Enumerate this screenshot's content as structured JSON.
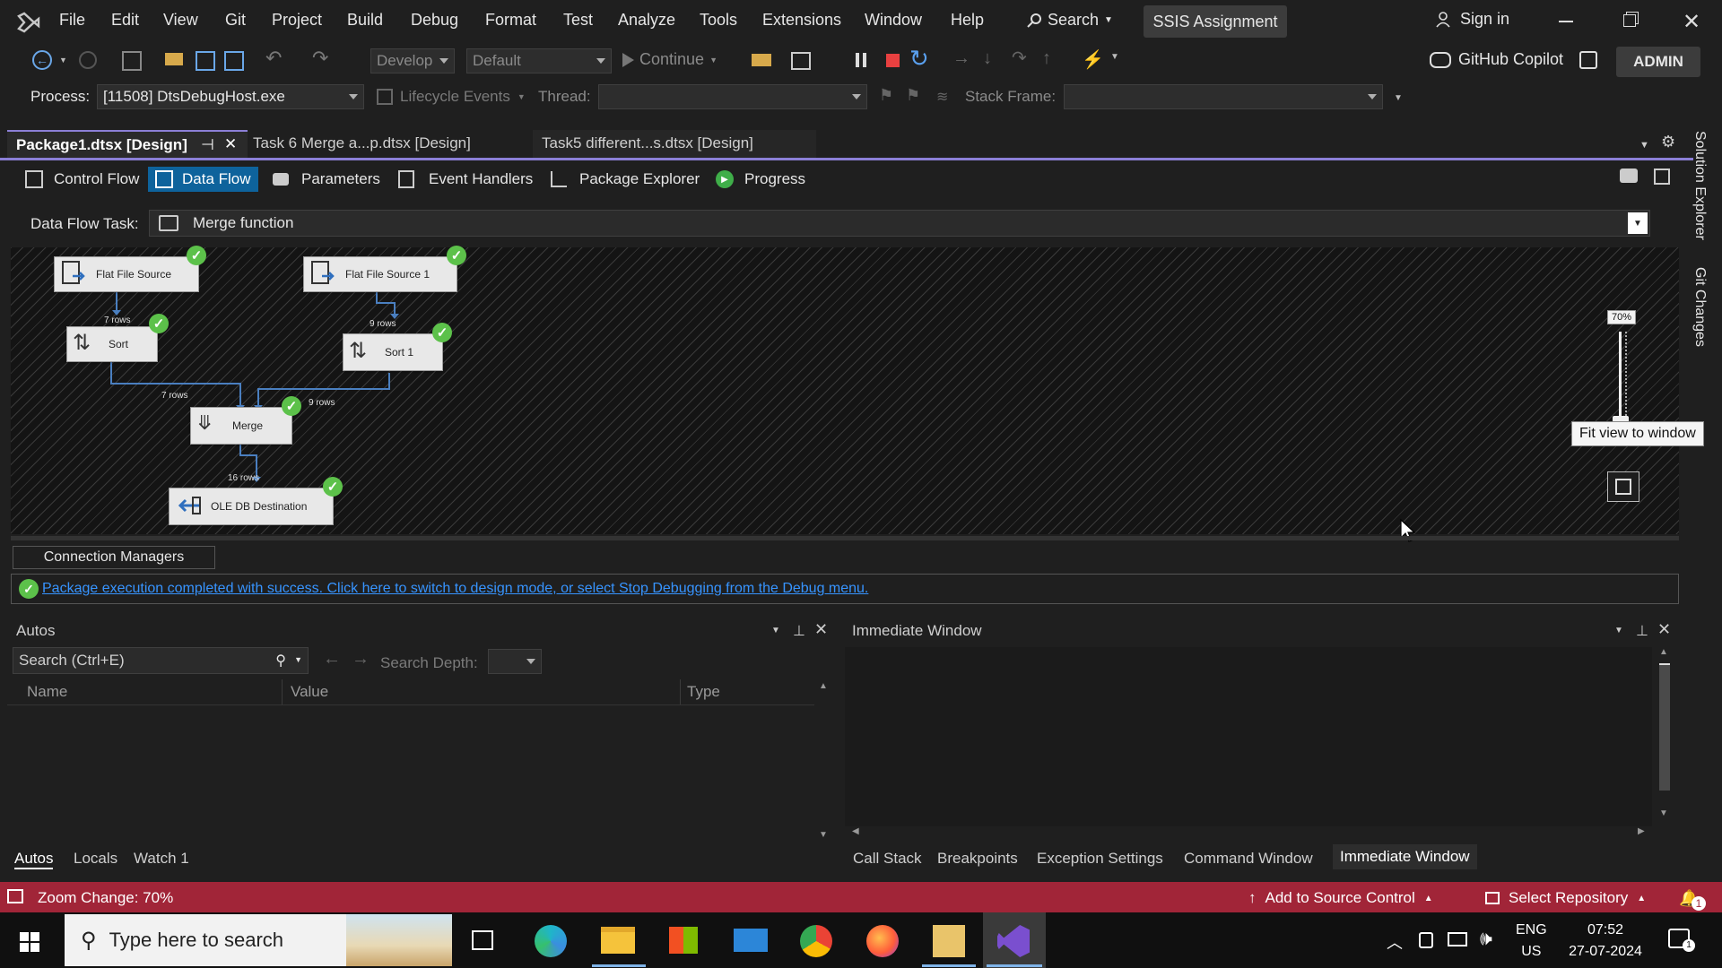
{
  "menubar": {
    "items": [
      "File",
      "Edit",
      "View",
      "Git",
      "Project",
      "Build",
      "Debug",
      "Format",
      "Test",
      "Analyze",
      "Tools",
      "Extensions",
      "Window",
      "Help"
    ],
    "search_label": "Search",
    "solution_name": "SSIS Assignment",
    "sign_in": "Sign in"
  },
  "toolbar": {
    "config_dropdown": "Develop",
    "platform_dropdown": "Default",
    "continue_label": "Continue",
    "copilot_label": "GitHub Copilot",
    "admin_label": "ADMIN"
  },
  "debugbar": {
    "process_label": "Process:",
    "process_value": "[11508] DtsDebugHost.exe",
    "lifecycle_label": "Lifecycle Events",
    "thread_label": "Thread:",
    "stackframe_label": "Stack Frame:"
  },
  "doc_tabs": [
    {
      "label": "Package1.dtsx [Design]"
    },
    {
      "label": "Task 6 Merge a...p.dtsx [Design]"
    },
    {
      "label": "Task5 different...s.dtsx [Design]"
    }
  ],
  "side_tabs": [
    "Solution Explorer",
    "Git Changes"
  ],
  "designer_tabs": [
    "Control Flow",
    "Data Flow",
    "Parameters",
    "Event Handlers",
    "Package Explorer",
    "Progress"
  ],
  "dataflow": {
    "task_label": "Data Flow Task:",
    "task_value": "Merge function"
  },
  "nodes": {
    "flat_file_source": "Flat File Source",
    "flat_file_source_1": "Flat File Source 1",
    "sort": "Sort",
    "sort_1": "Sort 1",
    "merge": "Merge",
    "ole_db_destination": "OLE DB Destination"
  },
  "row_labels": {
    "src_to_sort": "7 rows",
    "src1_to_sort1": "9 rows",
    "sort_to_merge": "7 rows",
    "sort1_to_merge": "9 rows",
    "merge_to_dest": "16 rows"
  },
  "zoom": {
    "value_label": "70%",
    "tooltip": "Fit view to window"
  },
  "connection_managers": "Connection Managers",
  "message": "Package execution completed with success. Click here to switch to design mode, or select Stop Debugging from the Debug menu.",
  "autos": {
    "title": "Autos",
    "search_placeholder": "Search (Ctrl+E)",
    "search_depth_label": "Search Depth:",
    "columns": [
      "Name",
      "Value",
      "Type"
    ]
  },
  "immediate": {
    "title": "Immediate Window"
  },
  "left_bottom_tabs": [
    "Autos",
    "Locals",
    "Watch 1"
  ],
  "right_bottom_tabs": [
    "Call Stack",
    "Breakpoints",
    "Exception Settings",
    "Command Window",
    "Immediate Window"
  ],
  "statusbar": {
    "zoom_change": "Zoom Change: 70%",
    "add_source_control": "Add to Source Control",
    "select_repository": "Select Repository",
    "notifications": "1"
  },
  "taskbar": {
    "search_placeholder": "Type here to search",
    "lang_top": "ENG",
    "lang_bottom": "US",
    "time": "07:52",
    "date": "27-07-2024"
  },
  "colors": {
    "accent": "#0e639c",
    "status": "#a12538",
    "success": "#5cc14a",
    "link": "#3794ff"
  }
}
